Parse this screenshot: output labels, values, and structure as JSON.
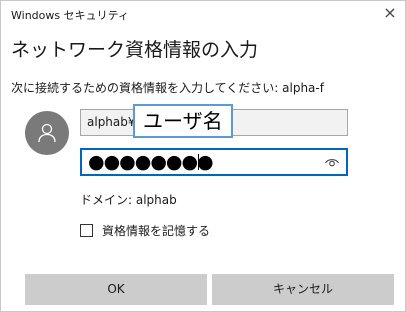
{
  "window": {
    "title": "Windows セキュリティ",
    "close_glyph": "×"
  },
  "dialog": {
    "heading": "ネットワーク資格情報の入力",
    "instruction": "次に接続するための資格情報を入力してください: alpha-f"
  },
  "credentials": {
    "avatar_icon": "user-icon",
    "username_value": "alphab¥",
    "username_tooltip": "ユーザ名",
    "password_dots": "●●●●●●●●",
    "reveal_icon": "eye-icon",
    "domain_text": "ドメイン: alphab"
  },
  "remember": {
    "label": "資格情報を記憶する",
    "checked": false
  },
  "buttons": {
    "ok_label": "OK",
    "cancel_label": "キャンセル"
  },
  "colors": {
    "focus_border": "#0067c0",
    "tooltip_border": "#5a9bd5",
    "button_bg": "#cccccc",
    "avatar_bg": "#7a7a7a"
  }
}
